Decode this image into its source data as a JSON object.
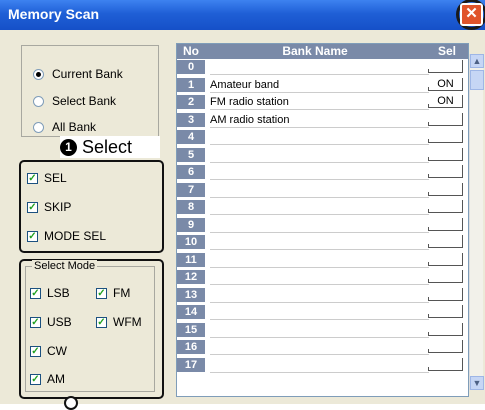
{
  "window": {
    "title": "Memory Scan"
  },
  "scan_range": {
    "options": [
      {
        "label": "Current Bank",
        "selected": true
      },
      {
        "label": "Select Bank",
        "selected": false
      },
      {
        "label": "All Bank",
        "selected": false
      }
    ]
  },
  "callout": {
    "number": "1",
    "text": "Select"
  },
  "scan_options": {
    "items": [
      {
        "label": "SEL",
        "checked": true
      },
      {
        "label": "SKIP",
        "checked": true
      },
      {
        "label": "MODE SEL",
        "checked": true
      }
    ]
  },
  "select_mode": {
    "legend": "Select Mode",
    "items": [
      {
        "label": "LSB",
        "checked": true
      },
      {
        "label": "FM",
        "checked": true
      },
      {
        "label": "USB",
        "checked": true
      },
      {
        "label": "WFM",
        "checked": true
      },
      {
        "label": "CW",
        "checked": true
      },
      {
        "label": "AM",
        "checked": true
      }
    ]
  },
  "bank_table": {
    "headers": {
      "no": "No",
      "name": "Bank Name",
      "sel": "Sel"
    },
    "rows": [
      {
        "no": "0",
        "name": "",
        "sel": ""
      },
      {
        "no": "1",
        "name": "Amateur band",
        "sel": "ON"
      },
      {
        "no": "2",
        "name": "FM radio station",
        "sel": "ON"
      },
      {
        "no": "3",
        "name": "AM radio station",
        "sel": ""
      },
      {
        "no": "4",
        "name": "",
        "sel": ""
      },
      {
        "no": "5",
        "name": "",
        "sel": ""
      },
      {
        "no": "6",
        "name": "",
        "sel": ""
      },
      {
        "no": "7",
        "name": "",
        "sel": ""
      },
      {
        "no": "8",
        "name": "",
        "sel": ""
      },
      {
        "no": "9",
        "name": "",
        "sel": ""
      },
      {
        "no": "10",
        "name": "",
        "sel": ""
      },
      {
        "no": "11",
        "name": "",
        "sel": ""
      },
      {
        "no": "12",
        "name": "",
        "sel": ""
      },
      {
        "no": "13",
        "name": "",
        "sel": ""
      },
      {
        "no": "14",
        "name": "",
        "sel": ""
      },
      {
        "no": "15",
        "name": "",
        "sel": ""
      },
      {
        "no": "16",
        "name": "",
        "sel": ""
      },
      {
        "no": "17",
        "name": "",
        "sel": ""
      }
    ]
  },
  "icons": {
    "close": "close-icon",
    "scroll_up": "chevron-up-icon",
    "scroll_down": "chevron-down-icon"
  },
  "colors": {
    "titlebar": "#1f5fd6",
    "table_header": "#7a8aa8",
    "close": "#e0542b"
  }
}
